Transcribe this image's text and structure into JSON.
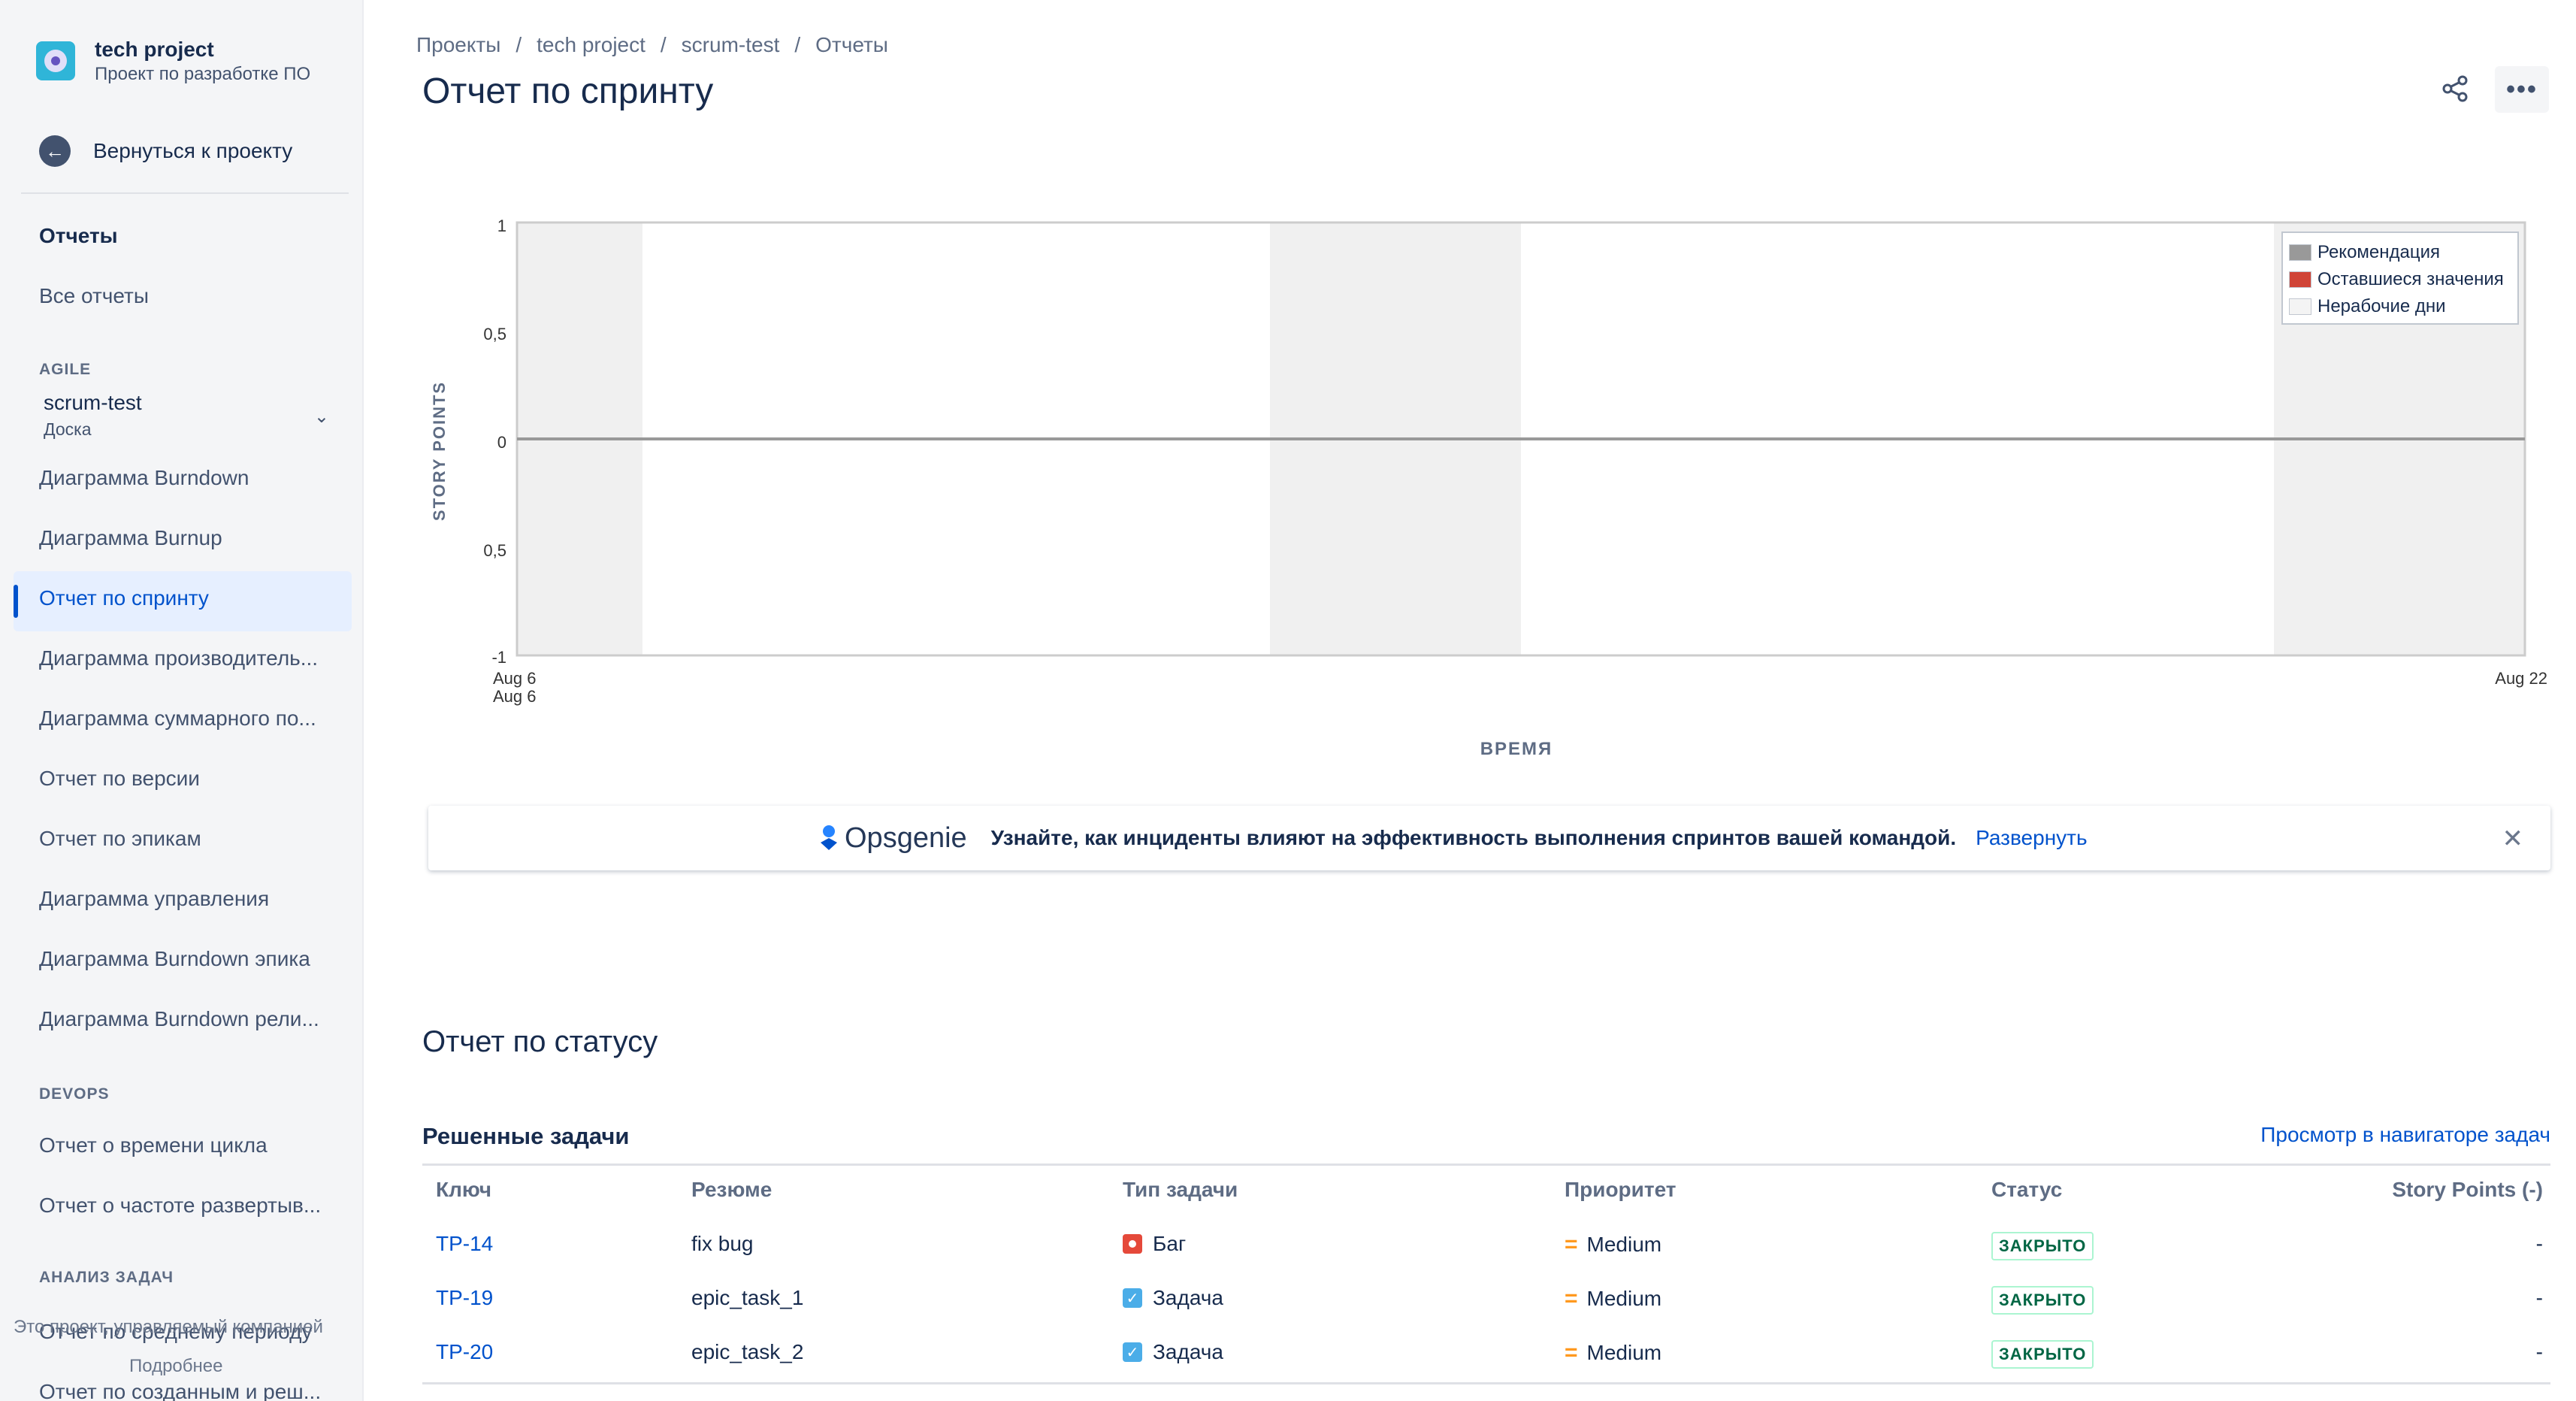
{
  "project": {
    "name": "tech project",
    "type": "Проект по разработке ПО"
  },
  "sidebar": {
    "back_label": "Вернуться к проекту",
    "reports_heading": "Отчеты",
    "all_reports": "Все отчеты",
    "agile_heading": "AGILE",
    "board": {
      "name": "scrum-test",
      "type": "Доска"
    },
    "agile_items": [
      "Диаграмма Burndown",
      "Диаграмма Burnup",
      "Отчет по спринту",
      "Диаграмма производитель...",
      "Диаграмма суммарного по...",
      "Отчет по версии",
      "Отчет по эпикам",
      "Диаграмма управления",
      "Диаграмма Burndown эпика",
      "Диаграмма Burndown рели..."
    ],
    "devops_heading": "DEVOPS",
    "devops_items": [
      "Отчет о времени цикла",
      "Отчет о частоте развертыв..."
    ],
    "analysis_heading": "АНАЛИЗ ЗАДАЧ",
    "analysis_items": [
      "Отчет по среднему периоду",
      "Отчет по созданным и реш..."
    ],
    "footer_note": "Это проект, управляемый компанией",
    "footer_more": "Подробнее"
  },
  "breadcrumb": [
    "Проекты",
    "tech project",
    "scrum-test",
    "Отчеты"
  ],
  "page_title": "Отчет по спринту",
  "chart_data": {
    "type": "line",
    "ylabel": "STORY POINTS",
    "xlabel": "ВРЕМЯ",
    "y_ticks": [
      "1",
      "0,5",
      "0",
      "0,5",
      "-1"
    ],
    "x_ticks": {
      "start": "Aug 6",
      "start_sub": "Aug 6",
      "end": "Aug 22"
    },
    "ylim": [
      -1,
      1
    ],
    "x_range": [
      "Aug 6",
      "Aug 22"
    ],
    "grid": false,
    "legend_position": "top-right",
    "series": [
      {
        "name": "Рекомендация",
        "color": "#999999",
        "x": [
          "Aug 6",
          "Aug 22"
        ],
        "values": [
          0,
          0
        ]
      },
      {
        "name": "Оставшиеся значения",
        "color": "#d04437",
        "x": [],
        "values": []
      }
    ],
    "non_working_days_label": "Нерабочие дни",
    "non_working_days_color": "#f0f0f0",
    "non_working_days": [
      [
        "Aug 6",
        "Aug 7"
      ],
      [
        "Aug 12",
        "Aug 14"
      ],
      [
        "Aug 20",
        "Aug 22"
      ]
    ]
  },
  "banner": {
    "logo": "Opsgenie",
    "text": "Узнайте, как инциденты влияют на эффективность выполнения спринтов вашей командой.",
    "link": "Развернуть"
  },
  "status_report": {
    "title": "Отчет по статусу",
    "subtitle": "Решенные задачи",
    "nav_link": "Просмотр в навигаторе задач",
    "columns": [
      "Ключ",
      "Резюме",
      "Тип задачи",
      "Приоритет",
      "Статус",
      "Story Points (-)"
    ],
    "rows": [
      {
        "key": "TP-14",
        "summary": "fix bug",
        "type": "Баг",
        "type_icon": "bug-icon",
        "priority": "Medium",
        "status": "ЗАКРЫТО",
        "sp": "-"
      },
      {
        "key": "TP-19",
        "summary": "epic_task_1",
        "type": "Задача",
        "type_icon": "task-icon",
        "priority": "Medium",
        "status": "ЗАКРЫТО",
        "sp": "-"
      },
      {
        "key": "TP-20",
        "summary": "epic_task_2",
        "type": "Задача",
        "type_icon": "task-icon",
        "priority": "Medium",
        "status": "ЗАКРЫТО",
        "sp": "-"
      }
    ]
  }
}
